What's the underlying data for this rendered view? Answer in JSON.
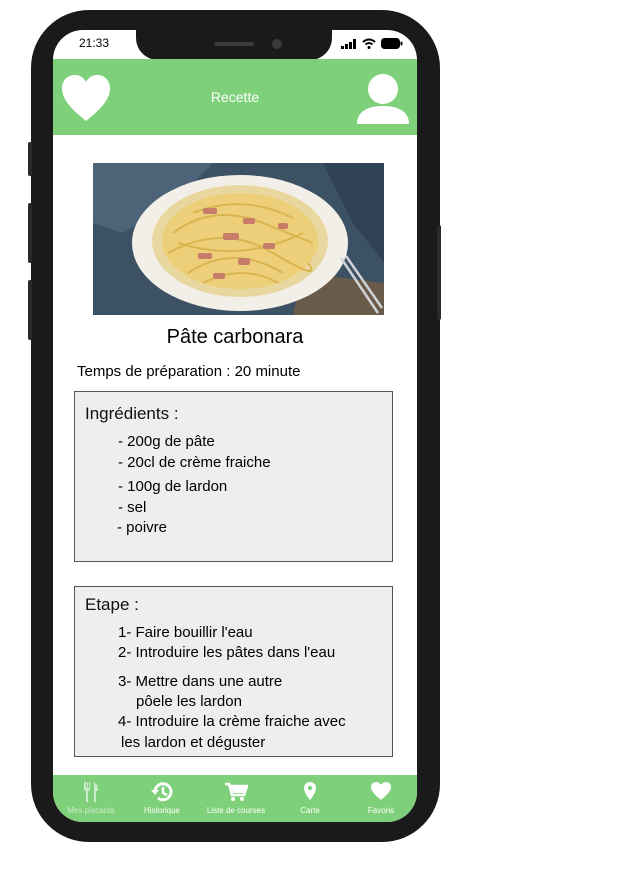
{
  "status_bar": {
    "time": "21:33"
  },
  "header": {
    "title": "Recette"
  },
  "recipe": {
    "title": "Pâte carbonara",
    "prep_time": "Temps de préparation : 20 minute",
    "ingredients": {
      "title": "Ingrédients :",
      "items": [
        "- 200g de pâte",
        "- 20cl de crème fraiche",
        "- 100g de lardon",
        "- sel",
        "- poivre"
      ]
    },
    "steps": {
      "title": "Etape :",
      "lines": [
        "1- Faire bouillir l'eau",
        "2- Introduire les pâtes dans l'eau",
        "3- Mettre dans une autre",
        "pôele les lardon",
        "4- Introduire la crème fraiche avec",
        "les lardon et déguster"
      ]
    }
  },
  "bottom_nav": [
    {
      "label": "Mes placards",
      "icon": "fork-knife-icon"
    },
    {
      "label": "Historique",
      "icon": "history-icon"
    },
    {
      "label": "Liste de courses",
      "icon": "cart-icon"
    },
    {
      "label": "Carte",
      "icon": "map-pin-icon"
    },
    {
      "label": "Favoris",
      "icon": "heart-icon"
    }
  ],
  "colors": {
    "accent": "#7ed07a",
    "box_bg": "#eeeeee",
    "phone_frame": "#1a1a1a"
  }
}
